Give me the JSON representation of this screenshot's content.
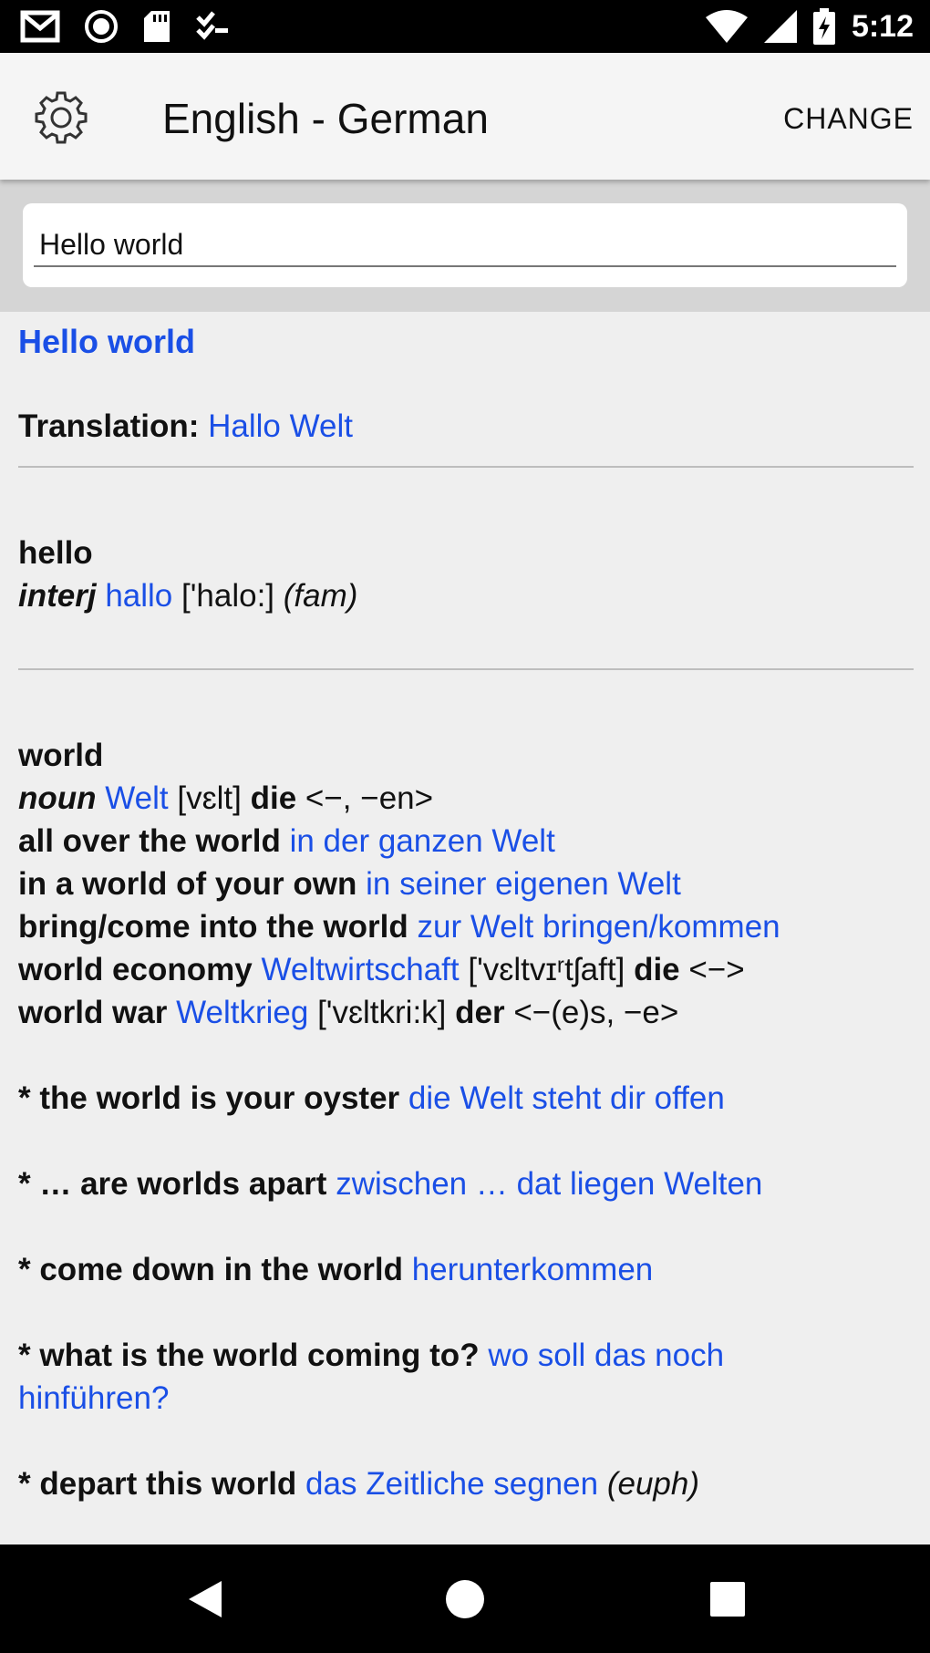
{
  "status_bar": {
    "time": "5:12",
    "icons": [
      "gmail-icon",
      "record-icon",
      "sd-card-icon",
      "checklist-icon",
      "wifi-icon",
      "signal-icon",
      "battery-icon"
    ]
  },
  "app_bar": {
    "title": "English - German",
    "change_label": "CHANGE",
    "settings_icon": "gear-icon"
  },
  "search": {
    "value": "Hello world"
  },
  "result": {
    "headword": "Hello world",
    "translation_label": "Translation:",
    "translation": "Hallo Welt"
  },
  "entries": {
    "hello": {
      "word": "hello",
      "pos": "interj",
      "translation": "hallo",
      "pron": "['halo:]",
      "note": "(fam)"
    },
    "world": {
      "word": "world",
      "pos": "noun",
      "translation": "Welt",
      "pron": "[vɛlt]",
      "article": "die",
      "inflection": "<−, −en>",
      "phrases": [
        {
          "en": "all over the world",
          "de": "in der ganzen Welt"
        },
        {
          "en": "in a world of your own",
          "de": "in seiner eigenen Welt"
        },
        {
          "en": "bring/come into the world",
          "de": "zur Welt bringen/kommen"
        },
        {
          "en": "world economy",
          "de": "Weltwirtschaft",
          "pron": "['vɛltvɪʳtʃaft]",
          "article": "die",
          "inflection": "<−>"
        },
        {
          "en": "world war",
          "de": "Weltkrieg",
          "pron": "['vɛltkri:k]",
          "article": "der",
          "inflection": "<−(e)s, −e>"
        }
      ],
      "idioms": [
        {
          "en": "* the world is your oyster",
          "de": "die Welt steht dir offen"
        },
        {
          "en": "* … are worlds apart",
          "de": "zwischen … dat liegen Welten"
        },
        {
          "en": "* come down in the world",
          "de": "herunterkommen"
        },
        {
          "en": "* what is the world coming to?",
          "de": "wo soll das noch hinführen?"
        },
        {
          "en": "* depart this world",
          "de": "das Zeitliche segnen",
          "note": "(euph)"
        }
      ]
    }
  },
  "colors": {
    "link_blue": "#1a4fe6",
    "status_bar": "#000000",
    "app_bar": "#f5f5f5",
    "search_band": "#d5d5d5",
    "content_bg": "#efefef"
  }
}
